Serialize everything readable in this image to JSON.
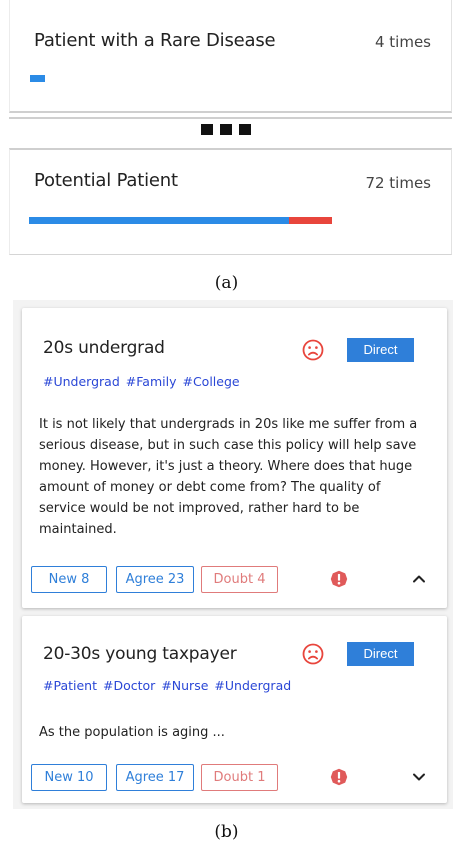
{
  "panel_a": {
    "card1": {
      "title": "Patient with a Rare Disease",
      "count": "4 times",
      "share": {
        "blue": 0.035
      }
    },
    "card2": {
      "title": "Potential Patient",
      "count": "72 times",
      "share": {
        "blue": 0.59,
        "red": 0.1
      }
    },
    "caption": "(a)"
  },
  "panel_b": {
    "caption": "(b)",
    "cards": [
      {
        "title": "20s undergrad",
        "mood_icon": "sad-face-icon",
        "direct_label": "Direct",
        "tags": [
          "#Undergrad",
          "#Family",
          "#College"
        ],
        "text": "It is not likely that undergrads in 20s like me suffer from a serious disease, but in such case this policy will help save money. However, it's just a theory. Where does that huge amount of money or debt come from? The quality of service would be not improved, rather hard to be maintained.",
        "new_label": "New 8",
        "agree_label": "Agree 23",
        "doubt_label": "Doubt 4",
        "expand_icon": "chevron-up-icon"
      },
      {
        "title": "20-30s young taxpayer",
        "mood_icon": "sad-face-icon",
        "direct_label": "Direct",
        "tags": [
          "#Patient",
          "#Doctor",
          "#Nurse",
          "#Undergrad"
        ],
        "text": "As the population is aging ...",
        "new_label": "New 10",
        "agree_label": "Agree 17",
        "doubt_label": "Doubt 1",
        "expand_icon": "chevron-down-icon"
      }
    ]
  },
  "colors": {
    "blue": "#2b8be6",
    "red": "#e8453c",
    "tag": "#2a47d6",
    "doubt": "#e07b7b"
  }
}
